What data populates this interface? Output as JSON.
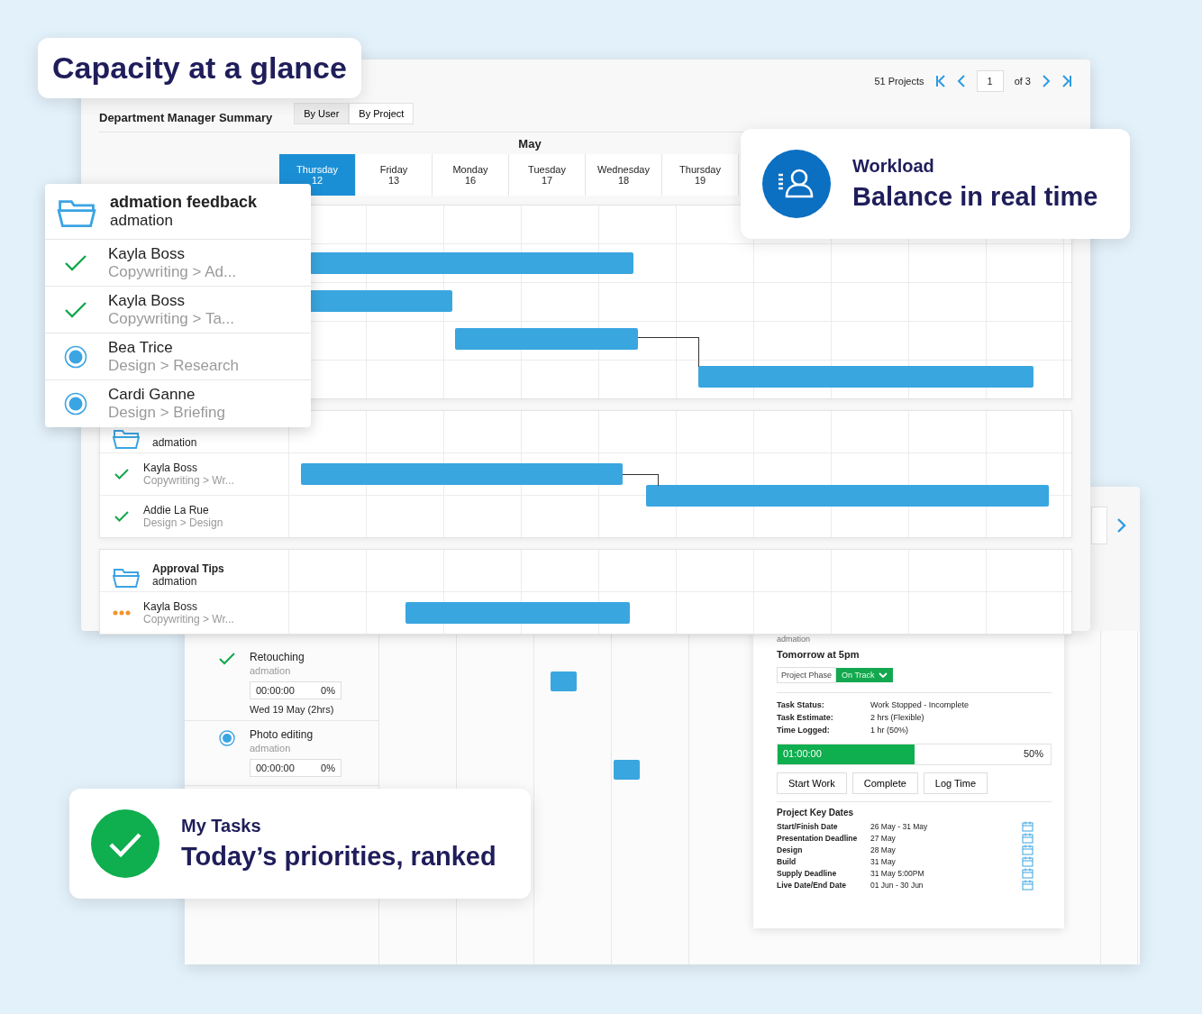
{
  "callouts": [
    {
      "kind": "title",
      "heading": "Capacity at a glance"
    },
    {
      "kind": "workload",
      "label": "Workload",
      "heading": "Balance in real time"
    },
    {
      "kind": "tasks",
      "label": "My Tasks",
      "heading": "Today’s priorities, ranked"
    }
  ],
  "summary_window": {
    "title": "Department Manager Summary",
    "view_tabs": [
      {
        "label": "By User",
        "selected": true
      },
      {
        "label": "By Project",
        "selected": false
      }
    ],
    "pagination": {
      "count": "51 Projects",
      "page": "1",
      "total": "of 3"
    },
    "month": "May",
    "days": [
      {
        "weekday": "Thursday",
        "date": "12",
        "selected": true
      },
      {
        "weekday": "Friday",
        "date": "13",
        "selected": false
      },
      {
        "weekday": "Monday",
        "date": "16",
        "selected": false
      },
      {
        "weekday": "Tuesday",
        "date": "17",
        "selected": false
      },
      {
        "weekday": "Wednesday",
        "date": "18",
        "selected": false
      },
      {
        "weekday": "Thursday",
        "date": "19",
        "selected": false
      }
    ],
    "groups": [
      {
        "subtitle": "admation",
        "rows": [
          {
            "name": "Kayla Boss",
            "detail": "Copywriting > Wr...",
            "kind": "done"
          },
          {
            "name": "Addie La Rue",
            "detail": "Design > Design",
            "kind": "done"
          }
        ]
      },
      {
        "title": "Approval Tips",
        "subtitle": "admation",
        "rows": [
          {
            "name": "Kayla Boss",
            "detail": "Copywriting > Wr...",
            "kind": "waiting"
          }
        ]
      }
    ]
  },
  "popup": {
    "title": "admation feedback",
    "subtitle": "admation",
    "rows": [
      {
        "name": "Kayla Boss",
        "detail": "Copywriting > Ad...",
        "kind": "done"
      },
      {
        "name": "Kayla Boss",
        "detail": "Copywriting > Ta...",
        "kind": "done"
      },
      {
        "name": "Bea Trice",
        "detail": "Design > Research",
        "kind": "active"
      },
      {
        "name": "Cardi Ganne",
        "detail": "Design > Briefing",
        "kind": "active"
      }
    ]
  },
  "tasks_window": {
    "tasks": [
      {
        "title": "Retouching",
        "project": "admation",
        "kind": "done",
        "timer": "00:00:00",
        "percent": "0%",
        "due": "Wed 19 May (2hrs)"
      },
      {
        "title": "Photo editing",
        "project": "admation",
        "kind": "active",
        "timer": "00:00:00",
        "percent": "0%"
      }
    ],
    "detail": {
      "project": "admation",
      "due": "Tomorrow at 5pm",
      "phase_label": "Project Phase",
      "phase_value": "On Track",
      "fields": [
        {
          "label": "Task Status:",
          "value": "Work Stopped - Incomplete"
        },
        {
          "label": "Task Estimate:",
          "value": "2 hrs (Flexible)"
        },
        {
          "label": "Time Logged:",
          "value": "1 hr (50%)"
        }
      ],
      "progress": {
        "level": 0.5,
        "time": "01:00:00",
        "percent": "50%"
      },
      "buttons": [
        "Start Work",
        "Complete",
        "Log Time"
      ],
      "key_dates": {
        "title": "Project Key Dates",
        "rows": [
          {
            "label": "Start/Finish Date",
            "value": "26 May - 31 May"
          },
          {
            "label": "Presentation Deadline",
            "value": "27 May"
          },
          {
            "label": "Design",
            "value": "28 May"
          },
          {
            "label": "Build",
            "value": "31 May"
          },
          {
            "label": "Supply Deadline",
            "value": "31 May 5:00PM"
          },
          {
            "label": "Live Date/End Date",
            "value": "01 Jun - 30 Jun"
          }
        ]
      }
    }
  }
}
